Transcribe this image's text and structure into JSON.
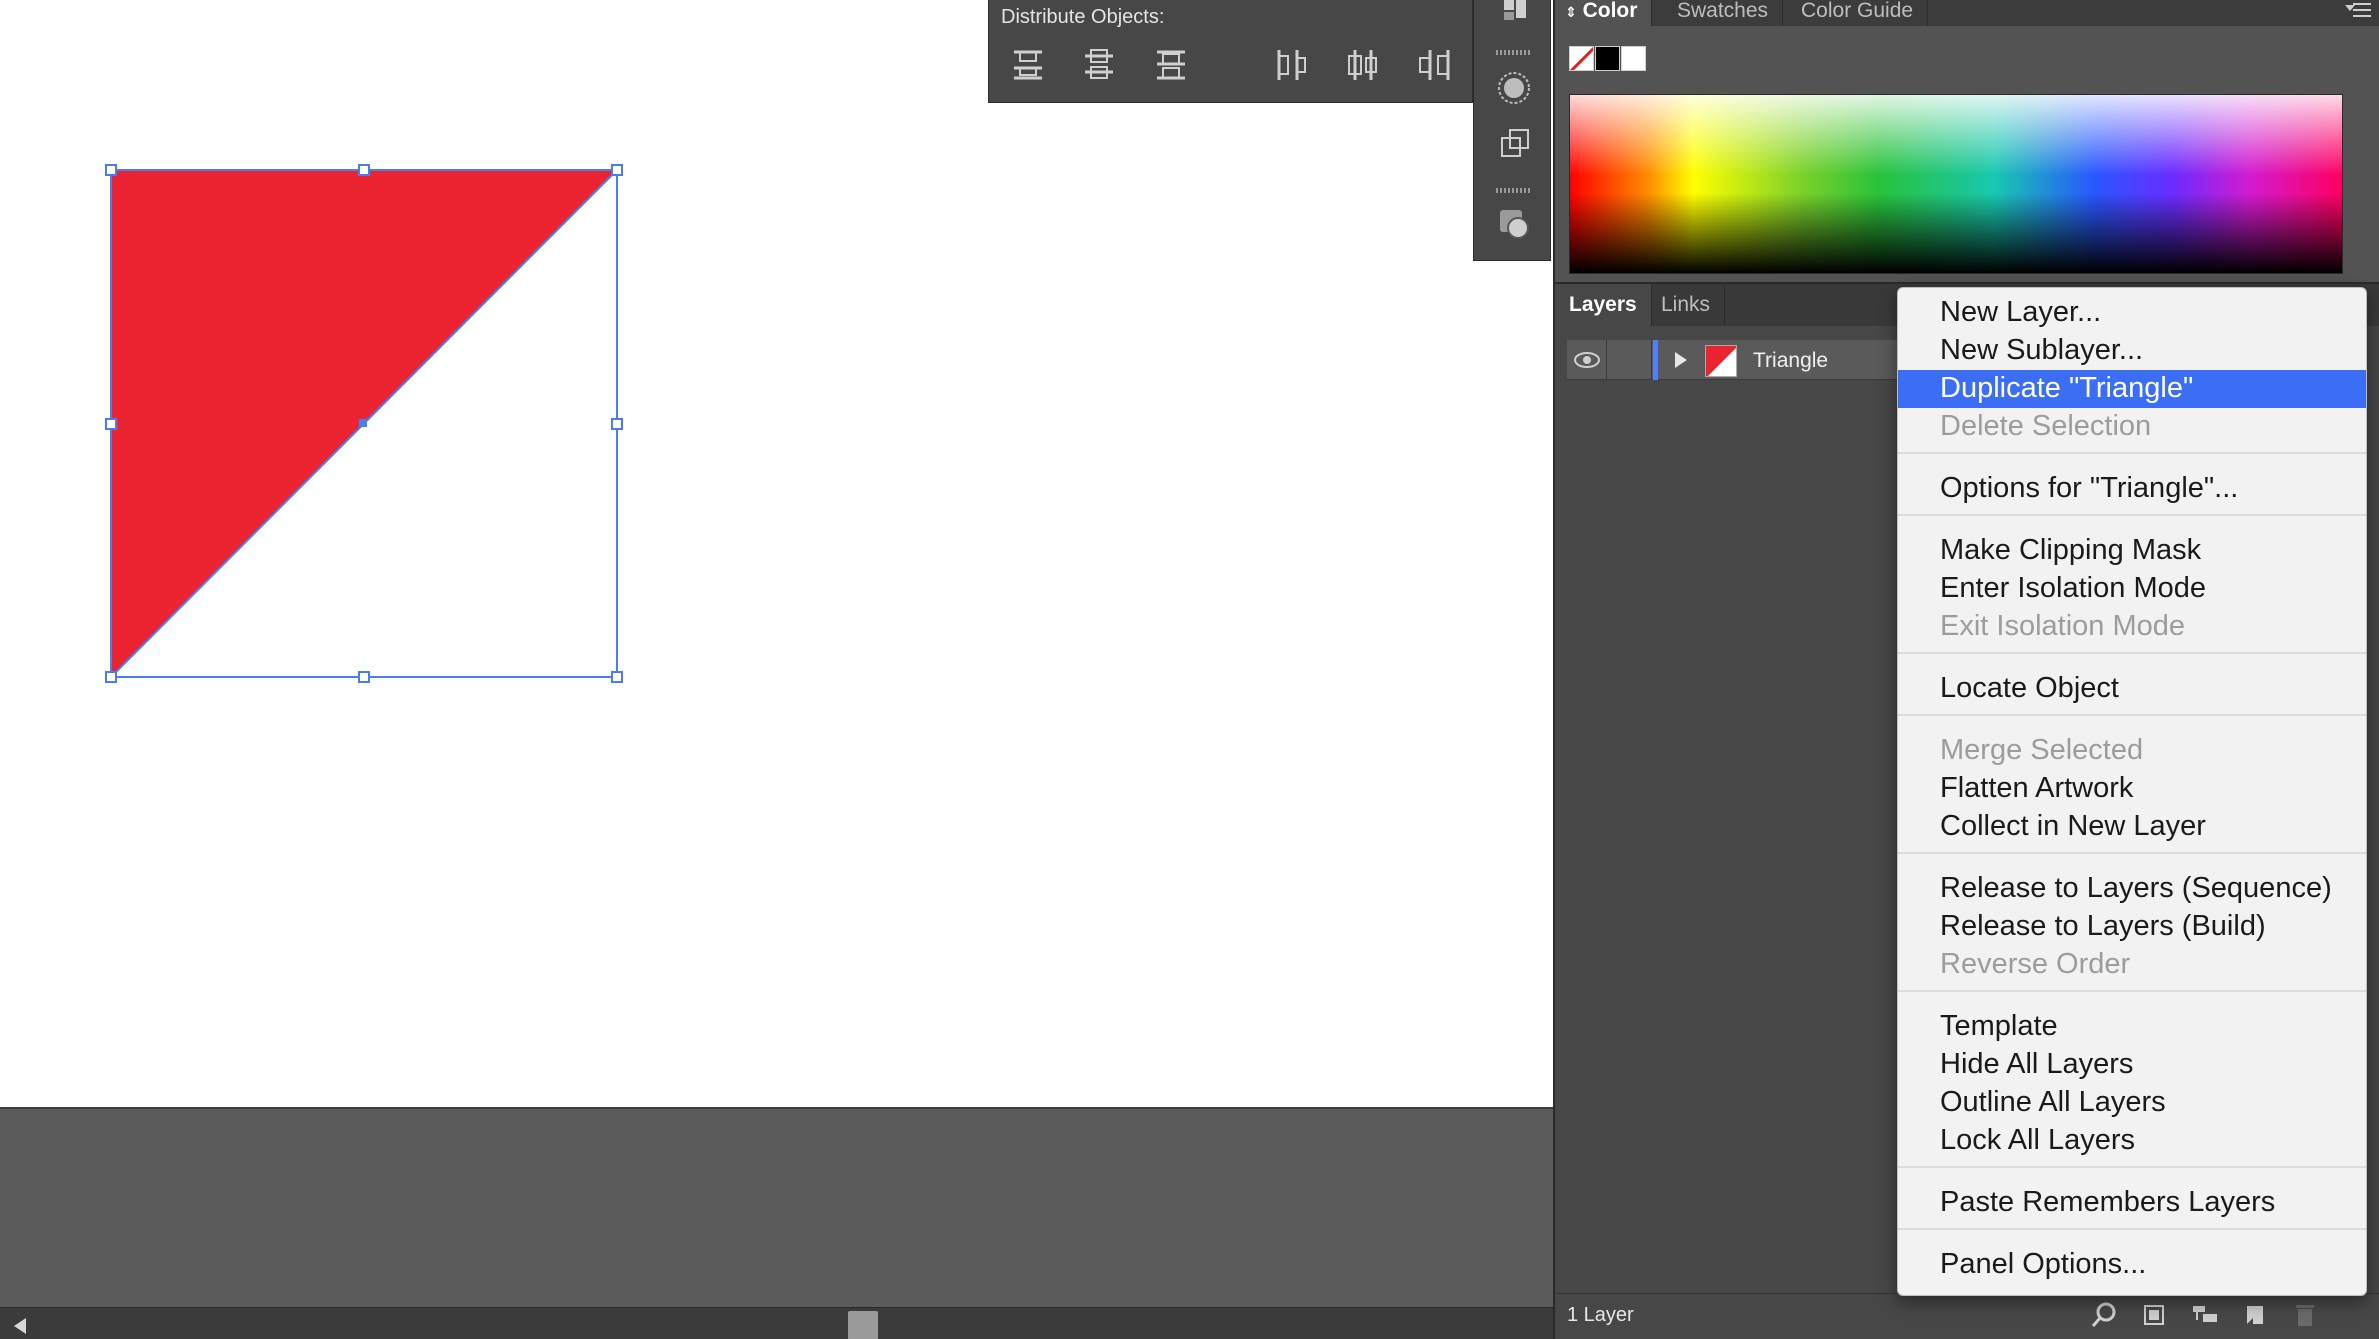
{
  "canvas": {
    "object_fill": "#ec2330",
    "selection_color": "#4a7ef0"
  },
  "distribute_panel": {
    "title": "Distribute Objects:",
    "buttons": [
      "vertical-distribute-top-icon",
      "vertical-distribute-center-icon",
      "vertical-distribute-bottom-icon",
      "horizontal-distribute-left-icon",
      "horizontal-distribute-center-icon",
      "horizontal-distribute-right-icon"
    ]
  },
  "color_panel": {
    "tabs": [
      {
        "label": "Color",
        "active": true
      },
      {
        "label": "Swatches",
        "active": false
      },
      {
        "label": "Color Guide",
        "active": false
      }
    ],
    "quick_swatches": [
      "none",
      "#000000",
      "#ffffff"
    ]
  },
  "layers_panel": {
    "tabs": [
      {
        "label": "Layers",
        "active": true
      },
      {
        "label": "Links",
        "active": false
      }
    ],
    "layers": [
      {
        "name": "Triangle",
        "visible": true,
        "color": "#4f7fff"
      }
    ],
    "footer": {
      "count_label": "1 Layer"
    }
  },
  "context_menu": {
    "groups": [
      [
        {
          "label": "New Layer...",
          "enabled": true
        },
        {
          "label": "New Sublayer...",
          "enabled": true
        },
        {
          "label": "Duplicate \"Triangle\"",
          "enabled": true,
          "selected": true
        },
        {
          "label": "Delete Selection",
          "enabled": false
        }
      ],
      [
        {
          "label": "Options for \"Triangle\"...",
          "enabled": true
        }
      ],
      [
        {
          "label": "Make Clipping Mask",
          "enabled": true
        },
        {
          "label": "Enter Isolation Mode",
          "enabled": true
        },
        {
          "label": "Exit Isolation Mode",
          "enabled": false
        }
      ],
      [
        {
          "label": "Locate Object",
          "enabled": true
        }
      ],
      [
        {
          "label": "Merge Selected",
          "enabled": false
        },
        {
          "label": "Flatten Artwork",
          "enabled": true
        },
        {
          "label": "Collect in New Layer",
          "enabled": true
        }
      ],
      [
        {
          "label": "Release to Layers (Sequence)",
          "enabled": true
        },
        {
          "label": "Release to Layers (Build)",
          "enabled": true
        },
        {
          "label": "Reverse Order",
          "enabled": false
        }
      ],
      [
        {
          "label": "Template",
          "enabled": true
        },
        {
          "label": "Hide All Layers",
          "enabled": true
        },
        {
          "label": "Outline All Layers",
          "enabled": true
        },
        {
          "label": "Lock All Layers",
          "enabled": true
        }
      ],
      [
        {
          "label": "Paste Remembers Layers",
          "enabled": true
        }
      ],
      [
        {
          "label": "Panel Options...",
          "enabled": true
        }
      ]
    ]
  }
}
